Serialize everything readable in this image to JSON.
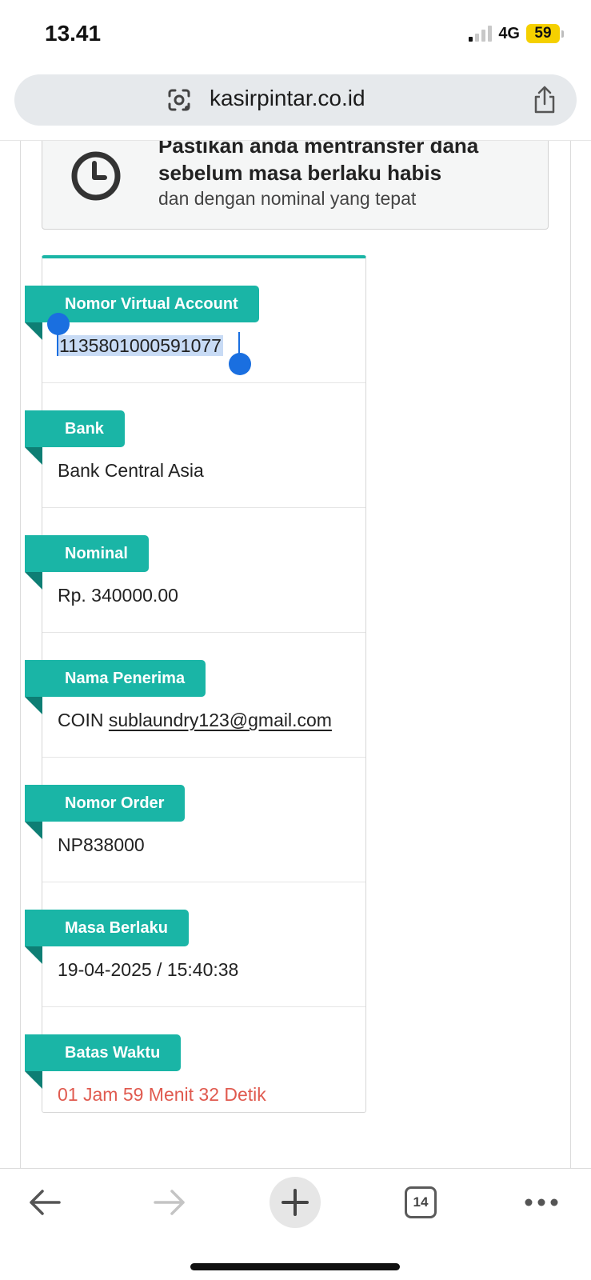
{
  "status_bar": {
    "time": "13.41",
    "network": "4G",
    "battery": "59"
  },
  "browser": {
    "url": "kasirpintar.co.id",
    "tabs_count": "14"
  },
  "notice": {
    "title": "Pastikan anda mentransfer dana sebelum masa berlaku habis",
    "subtitle": "dan dengan nominal yang tepat"
  },
  "payment": {
    "accent_color": "#1ab5a6",
    "rows": [
      {
        "label": "Nomor Virtual Account",
        "value": "1135801000591077"
      },
      {
        "label": "Bank",
        "value": "Bank Central Asia"
      },
      {
        "label": "Nominal",
        "value": "Rp. 340000.00"
      },
      {
        "label": "Nama Penerima",
        "value_prefix": "COIN",
        "value_email": "sublaundry123@gmail.com"
      },
      {
        "label": "Nomor Order",
        "value": "NP838000"
      },
      {
        "label": "Masa Berlaku",
        "value": "19-04-2025 / 15:40:38"
      },
      {
        "label": "Batas Waktu",
        "value": "01 Jam 59 Menit 32 Detik",
        "value_color": "#e05a4f"
      }
    ]
  },
  "toolbar": {
    "icons": [
      "back-arrow-icon",
      "forward-arrow-icon",
      "plus-icon",
      "tabs-icon",
      "more-icon"
    ]
  }
}
